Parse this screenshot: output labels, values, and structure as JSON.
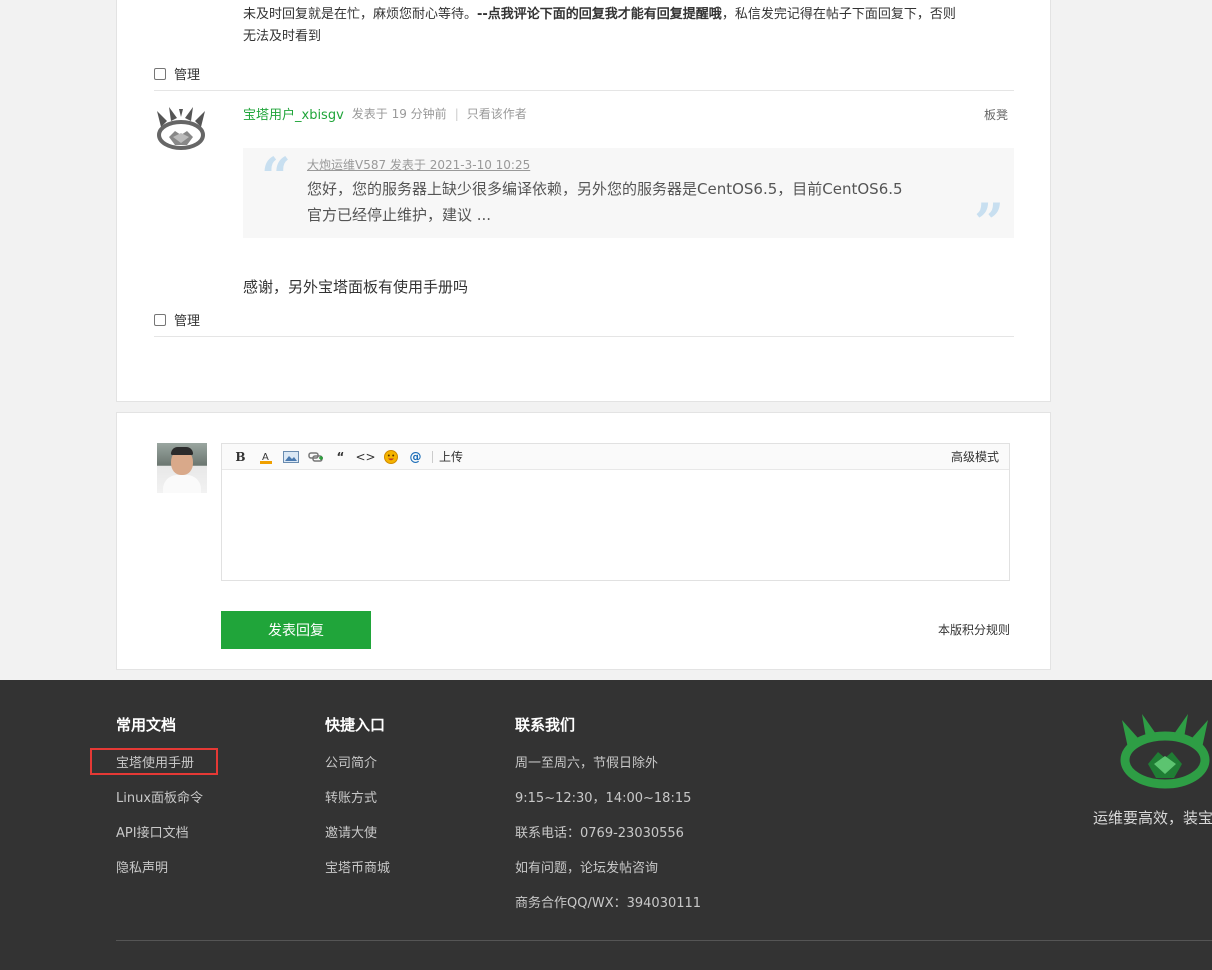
{
  "post_prev": {
    "line1_normal": "未及时回复就是在忙，麻烦您耐心等待。",
    "line1_bold": "--点我评论下面的回复我才能有回复提醒哦",
    "line1_tail": "，私信发完记得在帖子下面回复下，否则",
    "line2": "无法及时看到",
    "manage_label": "管理"
  },
  "post": {
    "username": "宝塔用户_xbisgv",
    "posted_label": "发表于 19 分钟前",
    "only_author": "只看该作者",
    "floor": "板凳",
    "quote_head": "大炮运维V587 发表于 2021-3-10 10:25",
    "quote_line1": "您好，您的服务器上缺少很多编译依赖，另外您的服务器是CentOS6.5，目前CentOS6.5",
    "quote_line2": "官方已经停止维护，建议 ...",
    "content": "感谢，另外宝塔面板有使用手册吗",
    "manage_label": "管理"
  },
  "reply": {
    "toolbar": {
      "bold": "B",
      "quote": "“",
      "code": "<>",
      "at": "@",
      "upload": "上传",
      "advanced": "高级模式"
    },
    "submit_label": "发表回复",
    "rules_label": "本版积分规则"
  },
  "footer": {
    "col1": {
      "title": "常用文档",
      "items": [
        "宝塔使用手册",
        "Linux面板命令",
        "API接口文档",
        "隐私声明"
      ]
    },
    "col2": {
      "title": "快捷入口",
      "items": [
        "公司简介",
        "转账方式",
        "邀请大使",
        "宝塔币商城"
      ]
    },
    "col3": {
      "title": "联系我们",
      "items": [
        "周一至周六，节假日除外",
        "9:15~12:30，14:00~18:15",
        "联系电话：0769-23030556",
        "如有问题，论坛发帖咨询",
        "商务合作QQ/WX：394030111"
      ]
    },
    "slogan": "运维要高效，装宝"
  },
  "colors": {
    "accent": "#20a53a",
    "footer_bg": "#333333",
    "highlight": "#e53935"
  }
}
